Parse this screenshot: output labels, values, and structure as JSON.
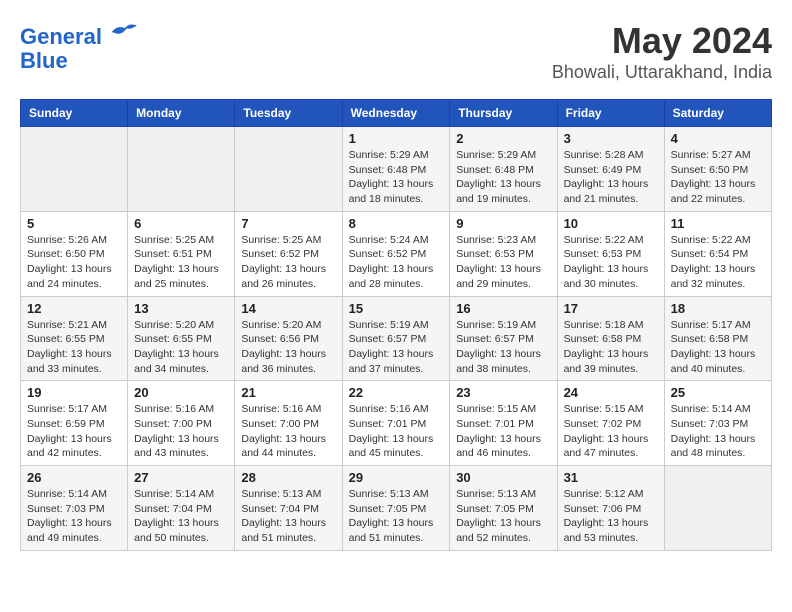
{
  "logo": {
    "line1": "General",
    "line2": "Blue"
  },
  "title": "May 2024",
  "subtitle": "Bhowali, Uttarakhand, India",
  "days_of_week": [
    "Sunday",
    "Monday",
    "Tuesday",
    "Wednesday",
    "Thursday",
    "Friday",
    "Saturday"
  ],
  "weeks": [
    [
      {
        "day": "",
        "info": ""
      },
      {
        "day": "",
        "info": ""
      },
      {
        "day": "",
        "info": ""
      },
      {
        "day": "1",
        "info": "Sunrise: 5:29 AM\nSunset: 6:48 PM\nDaylight: 13 hours and 18 minutes."
      },
      {
        "day": "2",
        "info": "Sunrise: 5:29 AM\nSunset: 6:48 PM\nDaylight: 13 hours and 19 minutes."
      },
      {
        "day": "3",
        "info": "Sunrise: 5:28 AM\nSunset: 6:49 PM\nDaylight: 13 hours and 21 minutes."
      },
      {
        "day": "4",
        "info": "Sunrise: 5:27 AM\nSunset: 6:50 PM\nDaylight: 13 hours and 22 minutes."
      }
    ],
    [
      {
        "day": "5",
        "info": "Sunrise: 5:26 AM\nSunset: 6:50 PM\nDaylight: 13 hours and 24 minutes."
      },
      {
        "day": "6",
        "info": "Sunrise: 5:25 AM\nSunset: 6:51 PM\nDaylight: 13 hours and 25 minutes."
      },
      {
        "day": "7",
        "info": "Sunrise: 5:25 AM\nSunset: 6:52 PM\nDaylight: 13 hours and 26 minutes."
      },
      {
        "day": "8",
        "info": "Sunrise: 5:24 AM\nSunset: 6:52 PM\nDaylight: 13 hours and 28 minutes."
      },
      {
        "day": "9",
        "info": "Sunrise: 5:23 AM\nSunset: 6:53 PM\nDaylight: 13 hours and 29 minutes."
      },
      {
        "day": "10",
        "info": "Sunrise: 5:22 AM\nSunset: 6:53 PM\nDaylight: 13 hours and 30 minutes."
      },
      {
        "day": "11",
        "info": "Sunrise: 5:22 AM\nSunset: 6:54 PM\nDaylight: 13 hours and 32 minutes."
      }
    ],
    [
      {
        "day": "12",
        "info": "Sunrise: 5:21 AM\nSunset: 6:55 PM\nDaylight: 13 hours and 33 minutes."
      },
      {
        "day": "13",
        "info": "Sunrise: 5:20 AM\nSunset: 6:55 PM\nDaylight: 13 hours and 34 minutes."
      },
      {
        "day": "14",
        "info": "Sunrise: 5:20 AM\nSunset: 6:56 PM\nDaylight: 13 hours and 36 minutes."
      },
      {
        "day": "15",
        "info": "Sunrise: 5:19 AM\nSunset: 6:57 PM\nDaylight: 13 hours and 37 minutes."
      },
      {
        "day": "16",
        "info": "Sunrise: 5:19 AM\nSunset: 6:57 PM\nDaylight: 13 hours and 38 minutes."
      },
      {
        "day": "17",
        "info": "Sunrise: 5:18 AM\nSunset: 6:58 PM\nDaylight: 13 hours and 39 minutes."
      },
      {
        "day": "18",
        "info": "Sunrise: 5:17 AM\nSunset: 6:58 PM\nDaylight: 13 hours and 40 minutes."
      }
    ],
    [
      {
        "day": "19",
        "info": "Sunrise: 5:17 AM\nSunset: 6:59 PM\nDaylight: 13 hours and 42 minutes."
      },
      {
        "day": "20",
        "info": "Sunrise: 5:16 AM\nSunset: 7:00 PM\nDaylight: 13 hours and 43 minutes."
      },
      {
        "day": "21",
        "info": "Sunrise: 5:16 AM\nSunset: 7:00 PM\nDaylight: 13 hours and 44 minutes."
      },
      {
        "day": "22",
        "info": "Sunrise: 5:16 AM\nSunset: 7:01 PM\nDaylight: 13 hours and 45 minutes."
      },
      {
        "day": "23",
        "info": "Sunrise: 5:15 AM\nSunset: 7:01 PM\nDaylight: 13 hours and 46 minutes."
      },
      {
        "day": "24",
        "info": "Sunrise: 5:15 AM\nSunset: 7:02 PM\nDaylight: 13 hours and 47 minutes."
      },
      {
        "day": "25",
        "info": "Sunrise: 5:14 AM\nSunset: 7:03 PM\nDaylight: 13 hours and 48 minutes."
      }
    ],
    [
      {
        "day": "26",
        "info": "Sunrise: 5:14 AM\nSunset: 7:03 PM\nDaylight: 13 hours and 49 minutes."
      },
      {
        "day": "27",
        "info": "Sunrise: 5:14 AM\nSunset: 7:04 PM\nDaylight: 13 hours and 50 minutes."
      },
      {
        "day": "28",
        "info": "Sunrise: 5:13 AM\nSunset: 7:04 PM\nDaylight: 13 hours and 51 minutes."
      },
      {
        "day": "29",
        "info": "Sunrise: 5:13 AM\nSunset: 7:05 PM\nDaylight: 13 hours and 51 minutes."
      },
      {
        "day": "30",
        "info": "Sunrise: 5:13 AM\nSunset: 7:05 PM\nDaylight: 13 hours and 52 minutes."
      },
      {
        "day": "31",
        "info": "Sunrise: 5:12 AM\nSunset: 7:06 PM\nDaylight: 13 hours and 53 minutes."
      },
      {
        "day": "",
        "info": ""
      }
    ]
  ]
}
